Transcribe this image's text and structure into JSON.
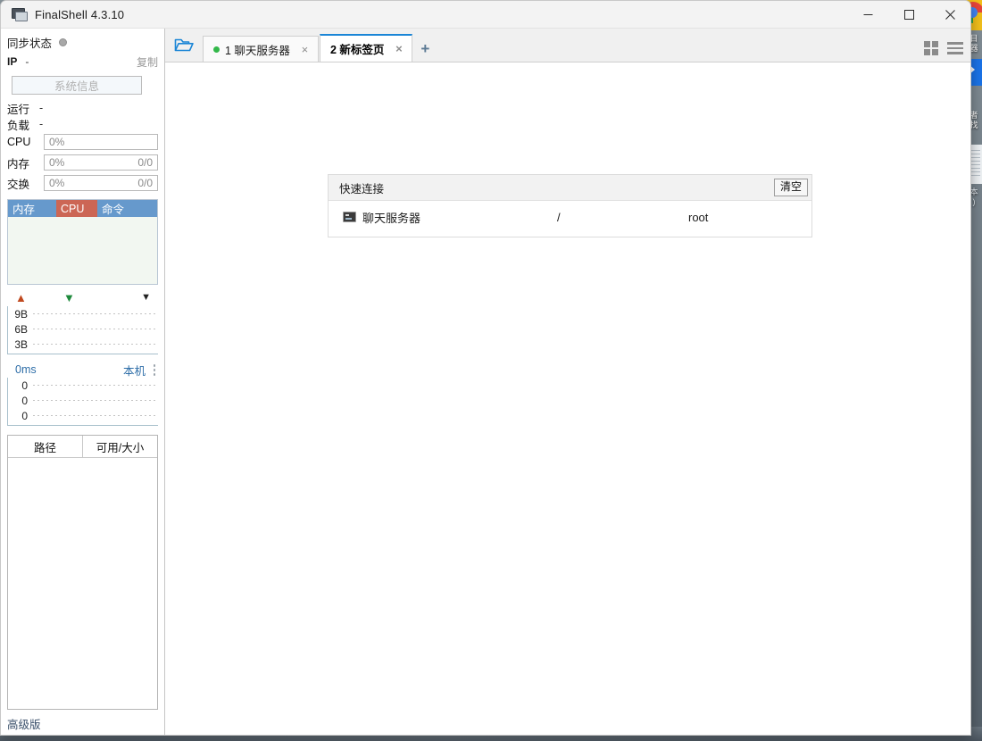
{
  "window": {
    "title": "FinalShell 4.3.10",
    "app_icon": "monitor-icon",
    "controls": {
      "minimize": "minimize-icon",
      "maximize": "maximize-icon",
      "close": "close-icon"
    }
  },
  "sidebar": {
    "sync": {
      "label": "同步状态",
      "status_color": "#a8a8a8"
    },
    "ip": {
      "key": "IP",
      "value": "-",
      "copy_label": "复制"
    },
    "sysinfo_button": "系统信息",
    "uptime": {
      "key": "运行",
      "value": "-"
    },
    "load": {
      "key": "负载",
      "value": "-"
    },
    "meters": [
      {
        "label": "CPU",
        "percent": "0%",
        "detail": ""
      },
      {
        "label": "内存",
        "percent": "0%",
        "detail": "0/0"
      },
      {
        "label": "交换",
        "percent": "0%",
        "detail": "0/0"
      }
    ],
    "process_table": {
      "columns": [
        "内存",
        "CPU",
        "命令"
      ],
      "column_colors": [
        "#6699cc",
        "#cc6655",
        "#6699cc"
      ],
      "rows": []
    },
    "net_graph": {
      "up_arrow": "arrow-up-icon",
      "down_arrow": "arrow-down-icon",
      "dropdown": "chevron-down-icon",
      "y_labels": [
        "9B",
        "6B",
        "3B"
      ]
    },
    "ping_graph": {
      "value": "0ms",
      "host": "本机",
      "y_labels": [
        "0",
        "0",
        "0"
      ]
    },
    "disk_table": {
      "columns": [
        "路径",
        "可用/大小"
      ],
      "rows": []
    },
    "footer_link": "高级版"
  },
  "toolbar": {
    "open_folder_icon": "open-folder-icon",
    "grid_view_icon": "grid-icon",
    "menu_icon": "hamburger-menu-icon"
  },
  "tabs": [
    {
      "label": "1 聊天服务器",
      "active": false,
      "has_status_dot": true,
      "status_color": "#33b84a",
      "close": "×"
    },
    {
      "label": "2 新标签页",
      "active": true,
      "has_status_dot": false,
      "close": "×"
    }
  ],
  "new_tab_button": "+",
  "quick_connect": {
    "title": "快速连接",
    "clear_button": "清空",
    "rows": [
      {
        "icon": "terminal-icon",
        "name": "聊天服务器",
        "path": "/",
        "user": "root"
      }
    ]
  },
  "desktop": {
    "labels": [
      "目\n器",
      "者\n找",
      "本\n)"
    ]
  }
}
